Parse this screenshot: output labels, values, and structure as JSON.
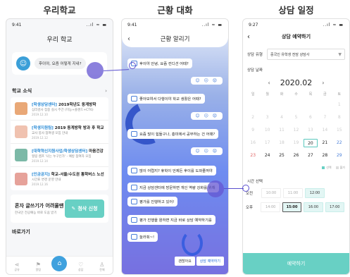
{
  "titles": {
    "left": "우리학교",
    "middle": "근황 대화",
    "right": "상담 일정"
  },
  "phone1": {
    "time": "9:41",
    "signal": "..ıl ≈ ▬",
    "app_title": "우리 학교",
    "greeting": "후이야, 요즘 어떻게 지내?",
    "news_header": "학교 소식",
    "news": [
      {
        "tag": "[학생상담센터]",
        "title": " 2019학년도 동계방학",
        "sub": "심리검사 집중 실시 주간 (미능+플랜드+CT6)",
        "date": "2019.12.10",
        "color": "#e9a877"
      },
      {
        "tag": "[학생지원팀]",
        "title": " 2019 동계방학 방과 후 학교",
        "sub": "교사 봉사 참여생 모집 안내",
        "date": "2019.12.12",
        "color": "#f0c2b0"
      },
      {
        "tag": "[대학혁신지원사업/학생상담센터]",
        "title": " 마음건강",
        "sub": "힐링 캠프 '나는 누구인가' - 예방 참여자 모집",
        "date": "2019.12.14",
        "color": "#7cb9a7"
      },
      {
        "tag": "[인금공지]",
        "title": " 학교-서울/수도권 통학버스 노선",
        "sub": "시간표 변경 운영 안내",
        "date": "2019.12.16",
        "color": "#e6a29a"
      }
    ],
    "help_title": "혼자 글쓰기가 어려울땐",
    "help_sub": "한국인 전공예능 바로 도움 받기",
    "help_button": "첨삭 신청",
    "shortcut": "바로가기",
    "tabs": [
      "공유",
      "알림",
      "홈",
      "상담",
      "전체"
    ]
  },
  "phone2": {
    "time": "9:41",
    "title": "근황 알리기",
    "messages": [
      {
        "text": "후이야 안녕, 요즘 컨디션 어때?",
        "type": "bot"
      },
      {
        "text": "😊 😐 😟",
        "type": "emo"
      },
      {
        "text": "좋아보여서 다행이야 학교 생활은 어때?",
        "type": "bot"
      },
      {
        "text": "😊 😐 😟",
        "type": "emo"
      },
      {
        "text": "요즘 많이 힘들구나, 흥미에서 공부하는 건 어때?",
        "type": "bot"
      },
      {
        "text": "😊 😐 😟",
        "type": "emo"
      },
      {
        "text": "많이 어렵지? 휴학이 언제든 후이를 도와줄꺼야",
        "type": "bot"
      },
      {
        "text": "지금 상담센터에 방문하면 개인 역량 강화를 위해",
        "type": "bot"
      },
      {
        "text": "평가를 진행하고 있어!",
        "type": "bot"
      },
      {
        "text": "평가 진행을 원하면 지금 바로 상담 예약하기를",
        "type": "bot"
      },
      {
        "text": "눌러줘~!",
        "type": "bot"
      }
    ],
    "btn_close": "괜찮아요",
    "btn_reserve": "상담 예약하기"
  },
  "phone3": {
    "time": "9:27",
    "title": "상담 예약하기",
    "type_label": "상담 유형",
    "type_value": "중국인 유학생 전담 상담사",
    "date_label": "상담 날짜",
    "month": "2020.02",
    "dow": [
      "일",
      "월",
      "화",
      "수",
      "목",
      "금",
      "토"
    ],
    "days": [
      "",
      "",
      "",
      "",
      "",
      "",
      "1",
      "2",
      "3",
      "4",
      "5",
      "6",
      "7",
      "8",
      "9",
      "10",
      "11",
      "12",
      "13",
      "14",
      "15",
      "16",
      "17",
      "18",
      "19",
      "20",
      "21",
      "22",
      "23",
      "24",
      "25",
      "26",
      "27",
      "28",
      "29"
    ],
    "legend_sel": "선택",
    "legend_na": "불가",
    "time_label": "시간 선택",
    "am_label": "오전",
    "pm_label": "오후",
    "am_slots": [
      "10:00",
      "11:00",
      "12:00"
    ],
    "pm_slots": [
      "14:00",
      "15:00",
      "16:00",
      "17:00"
    ],
    "reserve": "예약하기",
    "accent": "#68d0c4"
  }
}
